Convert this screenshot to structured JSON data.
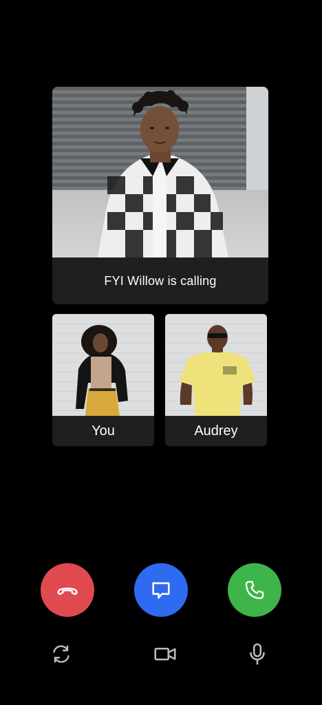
{
  "call": {
    "banner_text": "FYI Willow is calling"
  },
  "participants": [
    {
      "label": "You"
    },
    {
      "label": "Audrey"
    }
  ],
  "actions": {
    "decline": {
      "icon": "phone-hangup-icon",
      "color": "#E04A4F"
    },
    "message": {
      "icon": "message-bubble-icon",
      "color": "#2F6BF0"
    },
    "accept": {
      "icon": "phone-icon",
      "color": "#3DB54A"
    }
  },
  "utilities": {
    "rotate": {
      "icon": "rotate-camera-icon"
    },
    "video": {
      "icon": "video-camera-icon"
    },
    "mic": {
      "icon": "microphone-icon"
    }
  },
  "colors": {
    "background": "#000000",
    "card": "#1F1F22",
    "text": "#FFFFFF",
    "icon_muted": "#BDBDBD"
  }
}
